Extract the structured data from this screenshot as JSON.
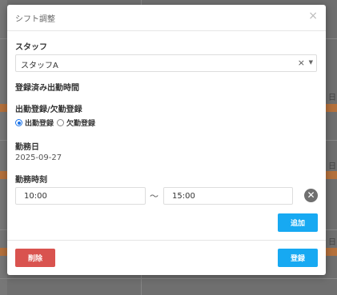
{
  "modal": {
    "title": "シフト調整",
    "close": "×",
    "staff_label": "スタッフ",
    "staff_value": "スタッフA",
    "registered_label": "登録済み出勤時間",
    "attendance_label": "出勤登録/欠勤登録",
    "radio_present": "出勤登録",
    "radio_absent": "欠勤登録",
    "date_label": "勤務日",
    "date_value": "2025-09-27",
    "time_label": "勤務時刻",
    "start_time": "10:00",
    "tilde": "〜",
    "end_time": "15:00",
    "add_button": "追加",
    "delete_button": "削除",
    "save_button": "登録"
  },
  "background": {
    "side_char": "日"
  },
  "colors": {
    "primary": "#17a9f2",
    "danger": "#d9534f",
    "radio_selected": "#1a73e8"
  }
}
